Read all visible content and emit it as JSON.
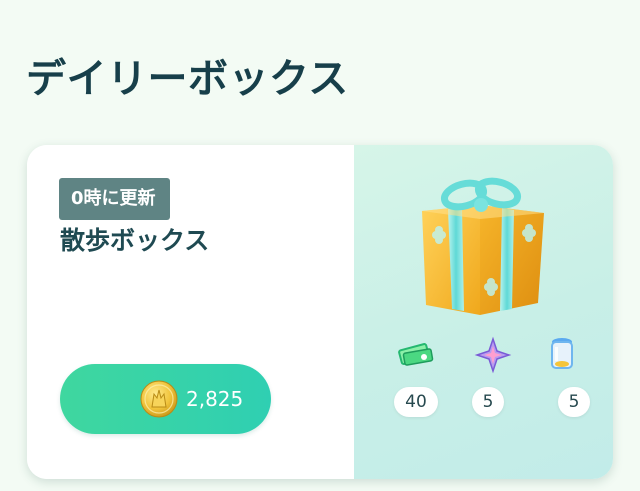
{
  "page": {
    "title": "デイリーボックス"
  },
  "box": {
    "refresh_badge": "0時に更新",
    "name": "散歩ボックス",
    "price": "2,825",
    "price_currency_icon": "pokecoin-icon",
    "image_icon": "gift-box-icon"
  },
  "contents": [
    {
      "icon": "pokeball-ticket-icon",
      "quantity": "40"
    },
    {
      "icon": "star-piece-icon",
      "quantity": "5"
    },
    {
      "icon": "incense-canister-icon",
      "quantity": "5"
    }
  ],
  "colors": {
    "background": "#f3fbf4",
    "title_text": "#173f4a",
    "badge_bg": "#5f8484",
    "button_gradient_start": "#3fd79f",
    "button_gradient_end": "#2fcfb2",
    "panel_right_bg": "#c8efe7"
  }
}
